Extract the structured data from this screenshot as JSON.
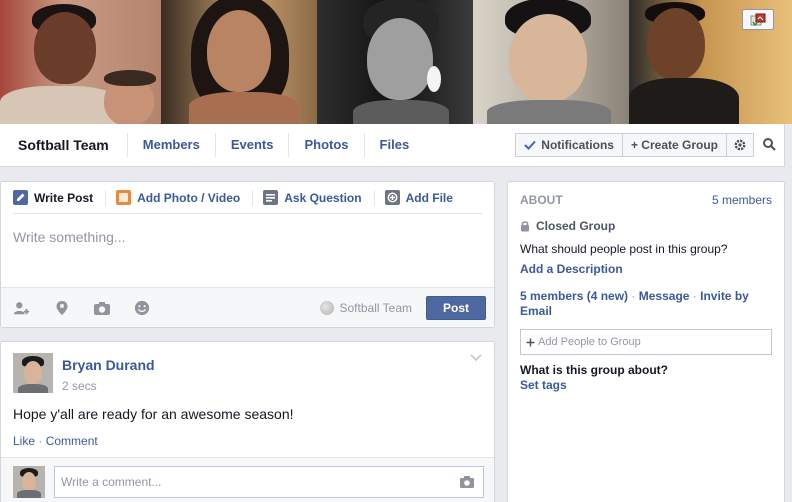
{
  "group": {
    "title": "Softball Team",
    "tabs": [
      "Members",
      "Events",
      "Photos",
      "Files"
    ],
    "notifications_label": "Notifications",
    "create_group_label": "+ Create Group"
  },
  "composer": {
    "tabs": [
      "Write Post",
      "Add Photo / Video",
      "Ask Question",
      "Add File"
    ],
    "placeholder": "Write something...",
    "audience": "Softball Team",
    "post_label": "Post",
    "footer_icons": [
      "tag-people-icon",
      "location-icon",
      "camera-icon",
      "emoticon-icon"
    ]
  },
  "story": {
    "author": "Bryan Durand",
    "time": "2 secs",
    "text": "Hope y'all are ready for an awesome season!",
    "like_label": "Like",
    "comment_label": "Comment",
    "comment_placeholder": "Write a comment..."
  },
  "about": {
    "title": "ABOUT",
    "member_count": "5 members",
    "privacy": "Closed Group",
    "question": "What should people post in this group?",
    "add_description": "Add a Description",
    "members_link": "5 members",
    "members_new": "(4 new)",
    "message_link": "Message",
    "invite_link": "Invite by Email",
    "add_people_placeholder": "Add People to Group",
    "about_question": "What is this group about?",
    "set_tags": "Set tags"
  },
  "colors": {
    "link_blue": "#3b5998",
    "post_button": "#4e69a2",
    "page_bg": "#e9eaed"
  }
}
